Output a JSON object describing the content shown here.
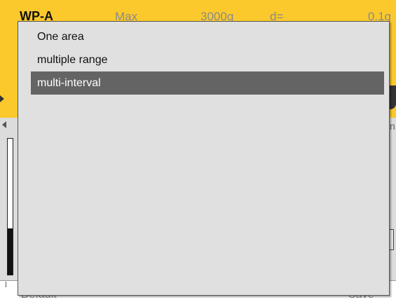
{
  "header": {
    "profile": "WP-A",
    "max_label": "Max",
    "capacity": "3000g",
    "d_label": "d=",
    "resolution": "0.1g"
  },
  "colors": {
    "header_background": "#fbc92b",
    "gray_area": "#dcdcdc",
    "popup_background": "#e0e0e0",
    "selected_item_background": "#646464",
    "selected_item_text": "#ffffff"
  },
  "level_indicator": {
    "fill_fraction": 0.34
  },
  "popup": {
    "items": [
      {
        "label": "One area",
        "selected": false
      },
      {
        "label": "multiple range",
        "selected": false
      },
      {
        "label": "multi-interval",
        "selected": true
      }
    ]
  },
  "footer": {
    "default_label": "Default",
    "save_label": "Save"
  }
}
